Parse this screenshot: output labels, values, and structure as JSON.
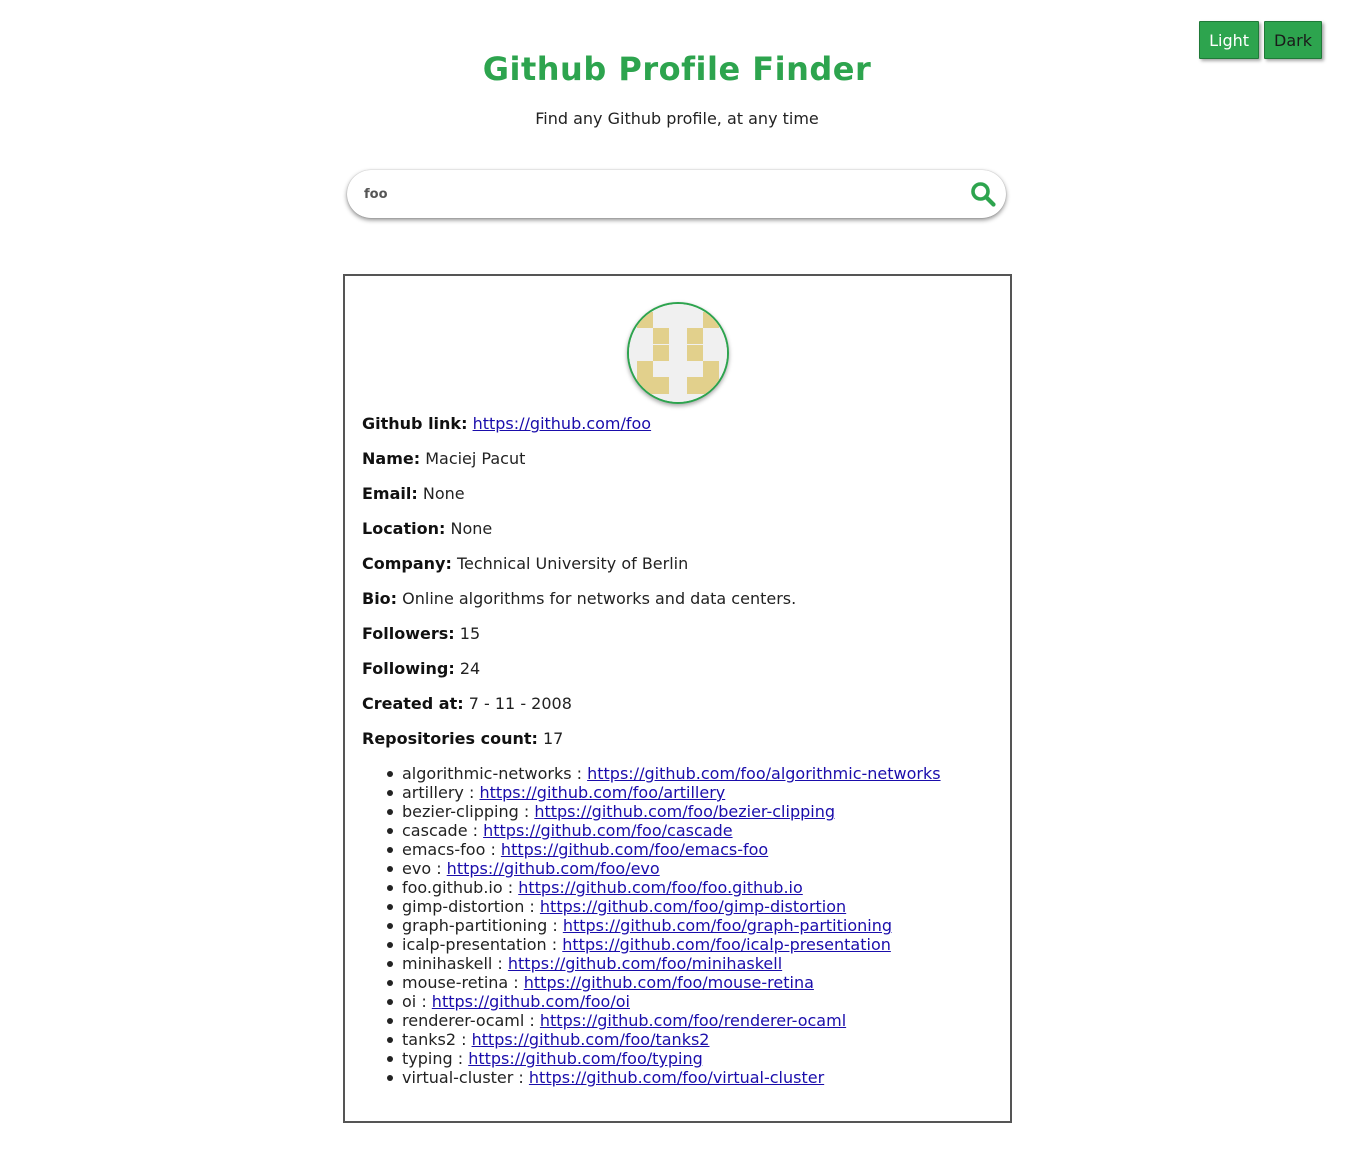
{
  "theme": {
    "light_label": "Light",
    "dark_label": "Dark",
    "accent": "#2da44e"
  },
  "header": {
    "title": "Github Profile Finder",
    "subtitle": "Find any Github profile, at any time"
  },
  "search": {
    "value": "foo",
    "icon": "search-icon"
  },
  "profile": {
    "avatar_icon": "identicon-avatar",
    "fields": [
      {
        "label": "Github link:",
        "value": "https://github.com/foo",
        "is_link": true
      },
      {
        "label": "Name:",
        "value": "Maciej Pacut"
      },
      {
        "label": "Email:",
        "value": "None"
      },
      {
        "label": "Location:",
        "value": "None"
      },
      {
        "label": "Company:",
        "value": "Technical University of Berlin"
      },
      {
        "label": "Bio:",
        "value": "Online algorithms for networks and data centers."
      },
      {
        "label": "Followers:",
        "value": "15"
      },
      {
        "label": "Following:",
        "value": "24"
      },
      {
        "label": "Created at:",
        "value": "7 - 11 - 2008"
      },
      {
        "label": "Repositories count:",
        "value": "17"
      }
    ],
    "repos": [
      {
        "name": "algorithmic-networks",
        "url": "https://github.com/foo/algorithmic-networks"
      },
      {
        "name": "artillery",
        "url": "https://github.com/foo/artillery"
      },
      {
        "name": "bezier-clipping",
        "url": "https://github.com/foo/bezier-clipping"
      },
      {
        "name": "cascade",
        "url": "https://github.com/foo/cascade"
      },
      {
        "name": "emacs-foo",
        "url": "https://github.com/foo/emacs-foo"
      },
      {
        "name": "evo",
        "url": "https://github.com/foo/evo"
      },
      {
        "name": "foo.github.io",
        "url": "https://github.com/foo/foo.github.io"
      },
      {
        "name": "gimp-distortion",
        "url": "https://github.com/foo/gimp-distortion"
      },
      {
        "name": "graph-partitioning",
        "url": "https://github.com/foo/graph-partitioning"
      },
      {
        "name": "icalp-presentation",
        "url": "https://github.com/foo/icalp-presentation"
      },
      {
        "name": "minihaskell",
        "url": "https://github.com/foo/minihaskell"
      },
      {
        "name": "mouse-retina",
        "url": "https://github.com/foo/mouse-retina"
      },
      {
        "name": "oi",
        "url": "https://github.com/foo/oi"
      },
      {
        "name": "renderer-ocaml",
        "url": "https://github.com/foo/renderer-ocaml"
      },
      {
        "name": "tanks2",
        "url": "https://github.com/foo/tanks2"
      },
      {
        "name": "typing",
        "url": "https://github.com/foo/typing"
      },
      {
        "name": "virtual-cluster",
        "url": "https://github.com/foo/virtual-cluster"
      }
    ]
  }
}
